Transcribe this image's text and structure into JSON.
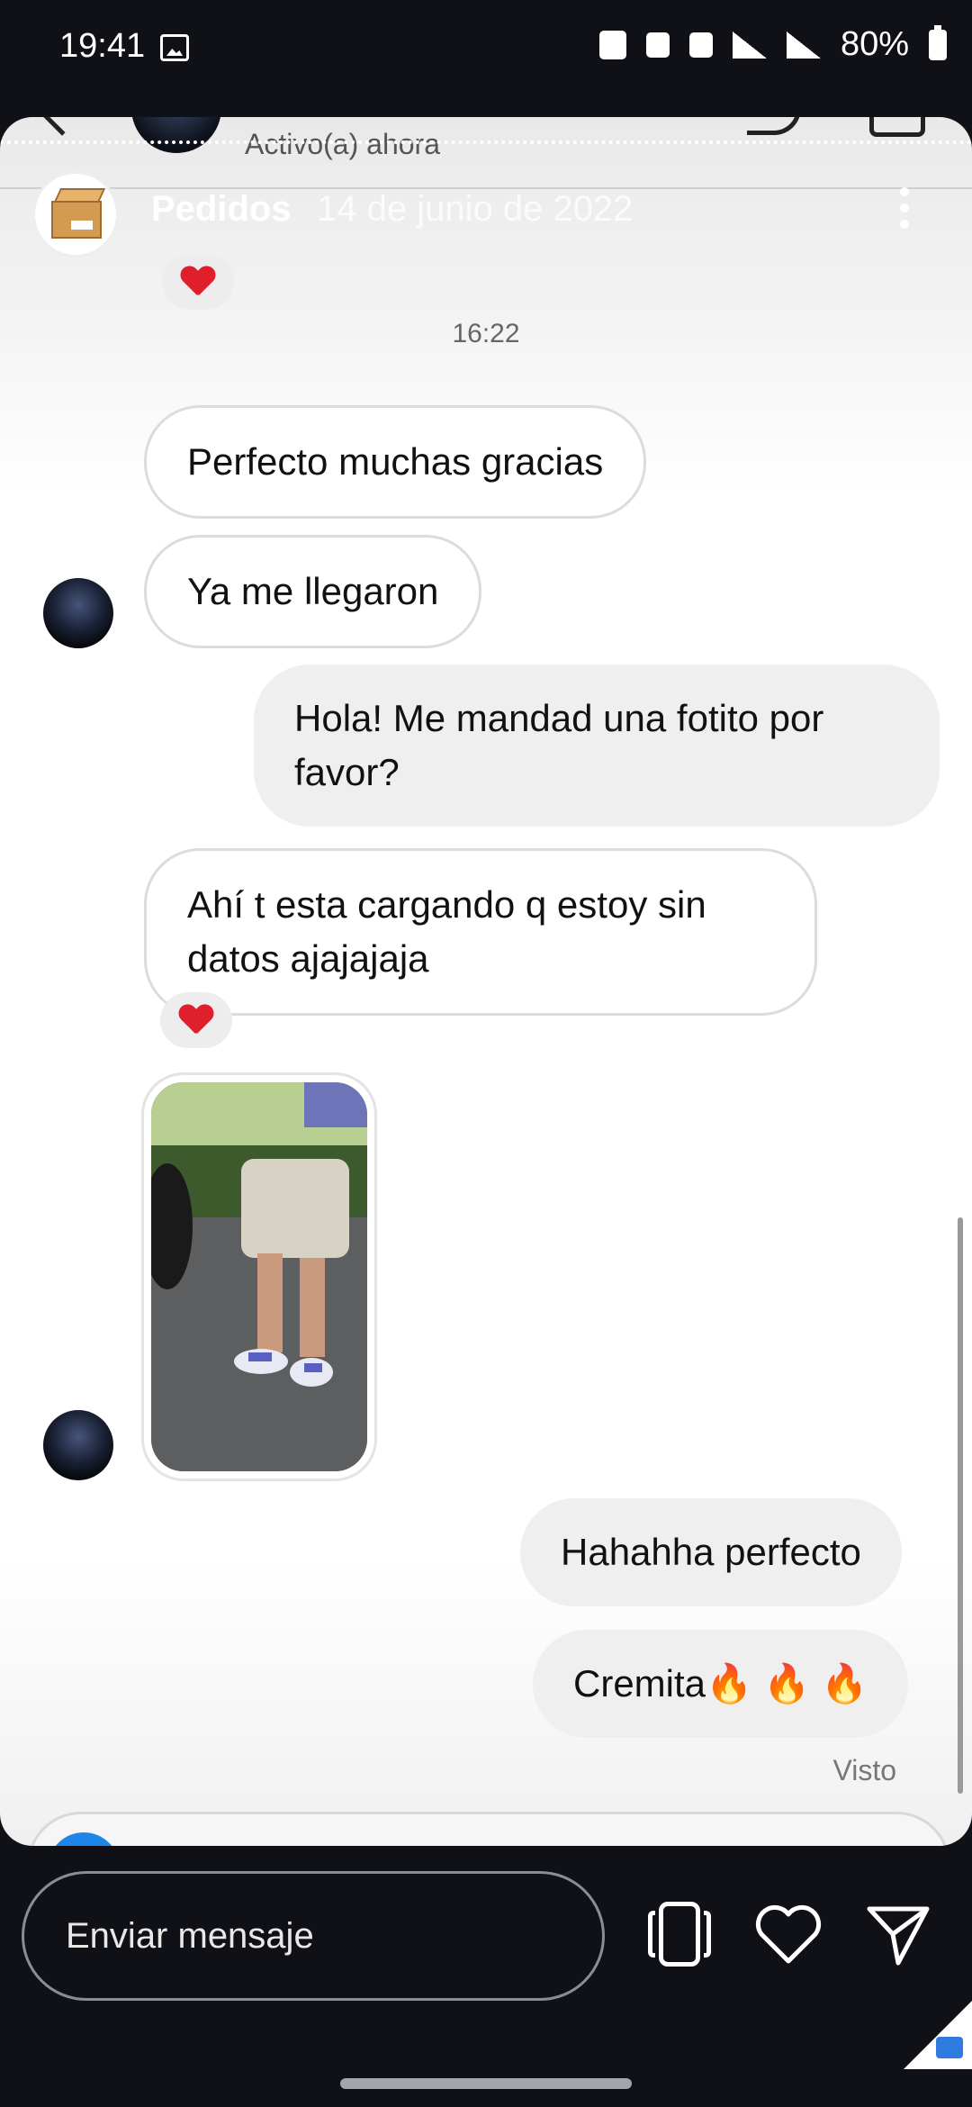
{
  "status_bar": {
    "time": "19:41",
    "battery": "80%",
    "icons": [
      "image-icon",
      "upload-icon",
      "nfc-icon",
      "mute-icon",
      "wifi-icon",
      "signal-icon",
      "battery-icon"
    ]
  },
  "chat_header": {
    "active_status": "Activo(a) ahora"
  },
  "story_bar": {
    "name": "Pedidos",
    "date": "14 de junio de 2022"
  },
  "timestamp": "16:22",
  "messages": [
    {
      "side": "in",
      "text": "Perfecto muchas gracias"
    },
    {
      "side": "in",
      "text": "Ya me llegaron"
    },
    {
      "side": "out",
      "text": "Hola! Me mandad una fotito por favor?"
    },
    {
      "side": "in",
      "text": "Ahí t esta cargando q estoy sin datos ajajajaja"
    },
    {
      "side": "out",
      "text": "Hahahha perfecto"
    },
    {
      "side": "out",
      "text": "Cremita🔥 🔥 🔥"
    }
  ],
  "seen_label": "Visto",
  "reply": {
    "placeholder": "Enviar mensaje"
  },
  "colors": {
    "background": "#0f1117",
    "in_bubble": "#ffffff",
    "out_bubble": "#efefef",
    "reaction_heart": "#e01f2d"
  }
}
